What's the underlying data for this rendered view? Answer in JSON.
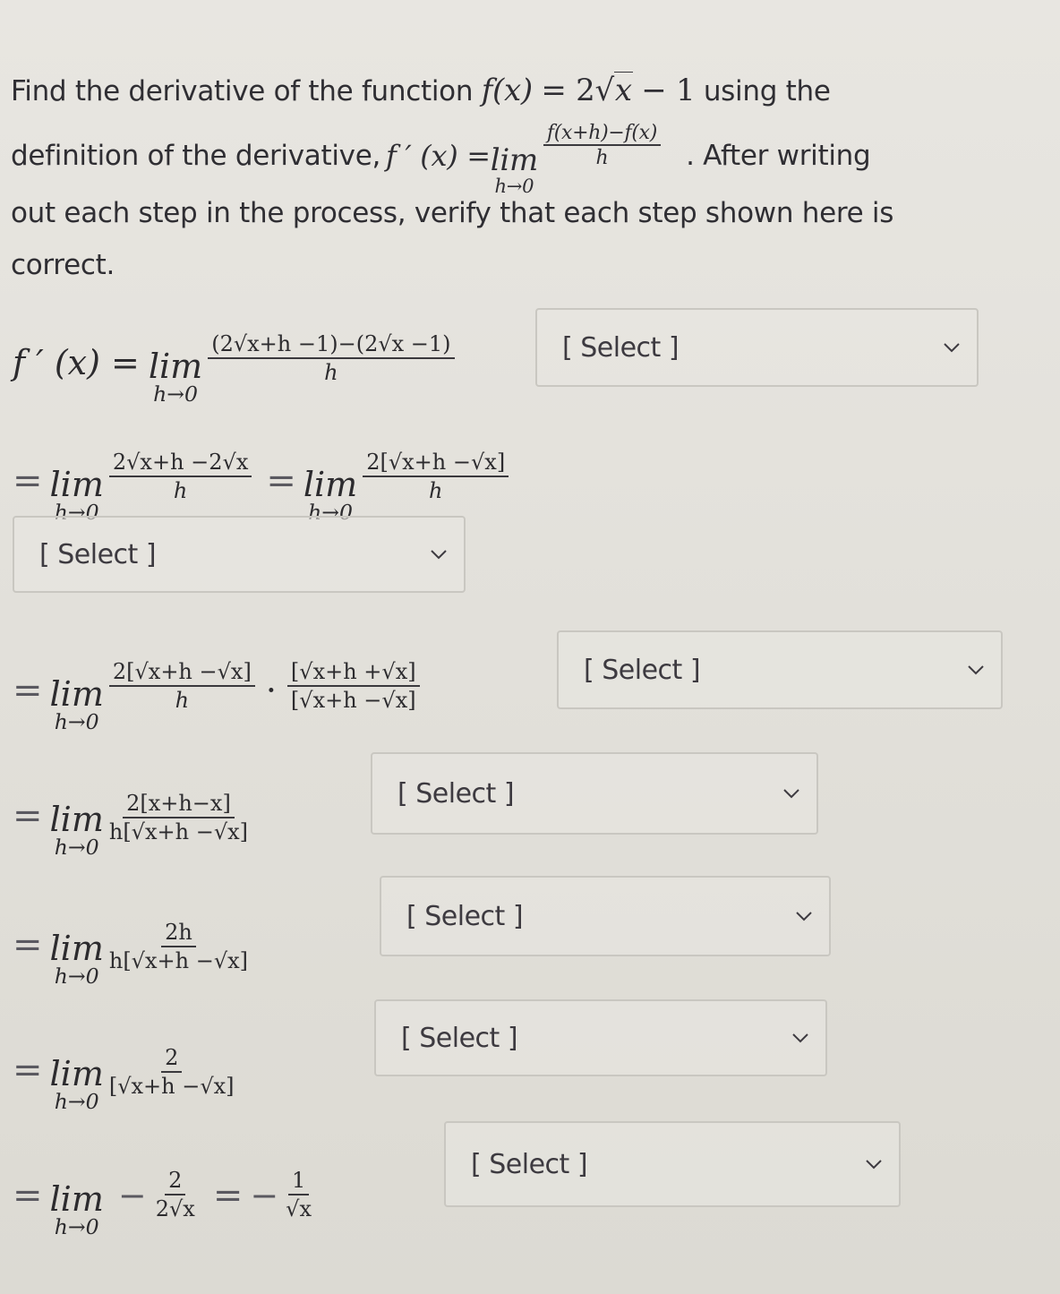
{
  "question": {
    "line1_prefix": "Find the derivative of the function ",
    "function_lhs": "f(x)",
    "function_eq": "= 2",
    "function_rad": "x",
    "function_tail": "− 1",
    "line1_suffix": " using the",
    "line2_prefix": "definition of the derivative, ",
    "deriv_lhs": "f ′ (x) = ",
    "lim_word": "lim",
    "lim_sub": "h→0",
    "def_num": "f(x+h)−f(x)",
    "def_den": "h",
    "line2_suffix": ". After writing",
    "line3": "out each step in the process, verify that each step shown here is",
    "line4": "correct."
  },
  "steps": [
    {
      "lhs": "f ′ (x) =",
      "lim": "lim",
      "sub": "h→0",
      "num": "(2√x+h −1)−(2√x −1)",
      "den": "h",
      "select": "[ Select ]"
    },
    {
      "lhs": "=",
      "lim": "lim",
      "sub": "h→0",
      "num": "2√x+h −2√x",
      "den": "h",
      "lhs2": "=",
      "lim2": "lim",
      "sub2": "h→0",
      "num2": "2[√x+h −√x]",
      "den2": "h",
      "select": "[ Select ]"
    },
    {
      "lhs": "=",
      "lim": "lim",
      "sub": "h→0",
      "num": "2[√x+h −√x]",
      "den": "h",
      "dot": "·",
      "num2": "[√x+h +√x]",
      "den2": "[√x+h −√x]",
      "select": "[ Select ]"
    },
    {
      "lhs": "=",
      "lim": "lim",
      "sub": "h→0",
      "num": "2[x+h−x]",
      "den": "h[√x+h −√x]",
      "select": "[ Select ]"
    },
    {
      "lhs": "=",
      "lim": "lim",
      "sub": "h→0",
      "num": "2h",
      "den": "h[√x+h −√x]",
      "select": "[ Select ]"
    },
    {
      "lhs": "=",
      "lim": "lim",
      "sub": "h→0",
      "num": "2",
      "den": "[√x+h −√x]",
      "select": "[ Select ]"
    },
    {
      "lhs": "=",
      "lim": "lim",
      "sub": "h→0",
      "neg": "−",
      "num": "2",
      "den": "2√x",
      "eq2": "=",
      "neg2": "−",
      "num2": "1",
      "den2": "√x",
      "select": "[ Select ]"
    }
  ],
  "icons": {
    "dropdown": "chevron-down-icon"
  }
}
